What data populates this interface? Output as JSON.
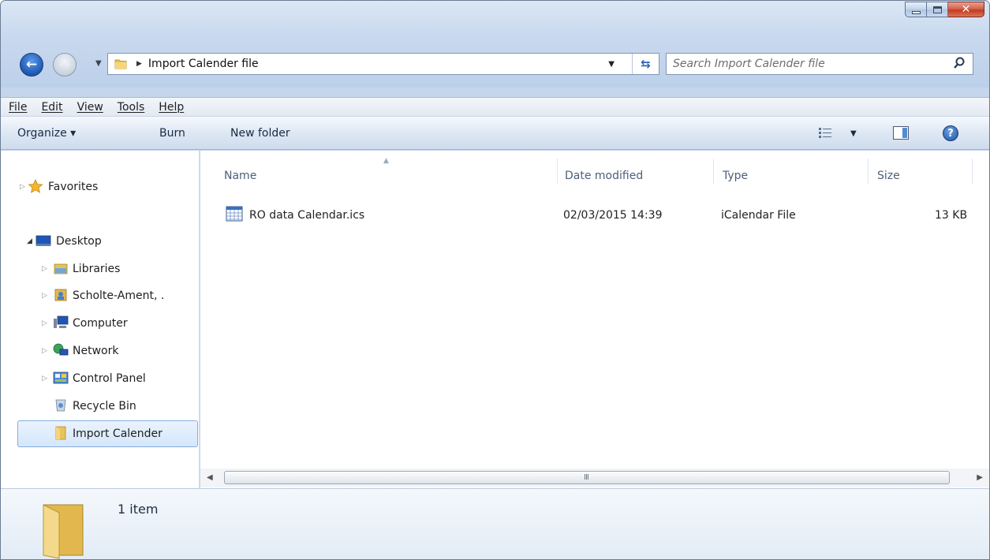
{
  "window": {
    "address_path": "Import Calender file",
    "search_placeholder": "Search Import Calender file",
    "close_glyph": "✕"
  },
  "menubar": {
    "items": [
      "File",
      "Edit",
      "View",
      "Tools",
      "Help"
    ]
  },
  "commandbar": {
    "organize": "Organize ▾",
    "burn": "Burn",
    "new_folder": "New folder",
    "help": "?"
  },
  "navpane": {
    "favorites": "Favorites",
    "desktop": "Desktop",
    "libraries": "Libraries",
    "user": "Scholte-Ament, .",
    "computer": "Computer",
    "network": "Network",
    "control_panel": "Control Panel",
    "recycle_bin": "Recycle Bin",
    "import_calender": "Import Calender"
  },
  "filelist": {
    "columns": [
      "Name",
      "Date modified",
      "Type",
      "Size"
    ],
    "rows": [
      {
        "name": "RO data Calendar.ics",
        "date": "02/03/2015 14:39",
        "type": "iCalendar File",
        "size": "13 KB"
      }
    ],
    "scroll_grip": "III"
  },
  "details": {
    "count": "1 item"
  },
  "colors": {
    "accent": "#2c64b8",
    "selection": "#d5e7fb",
    "chrome": "#c5d6ea"
  }
}
